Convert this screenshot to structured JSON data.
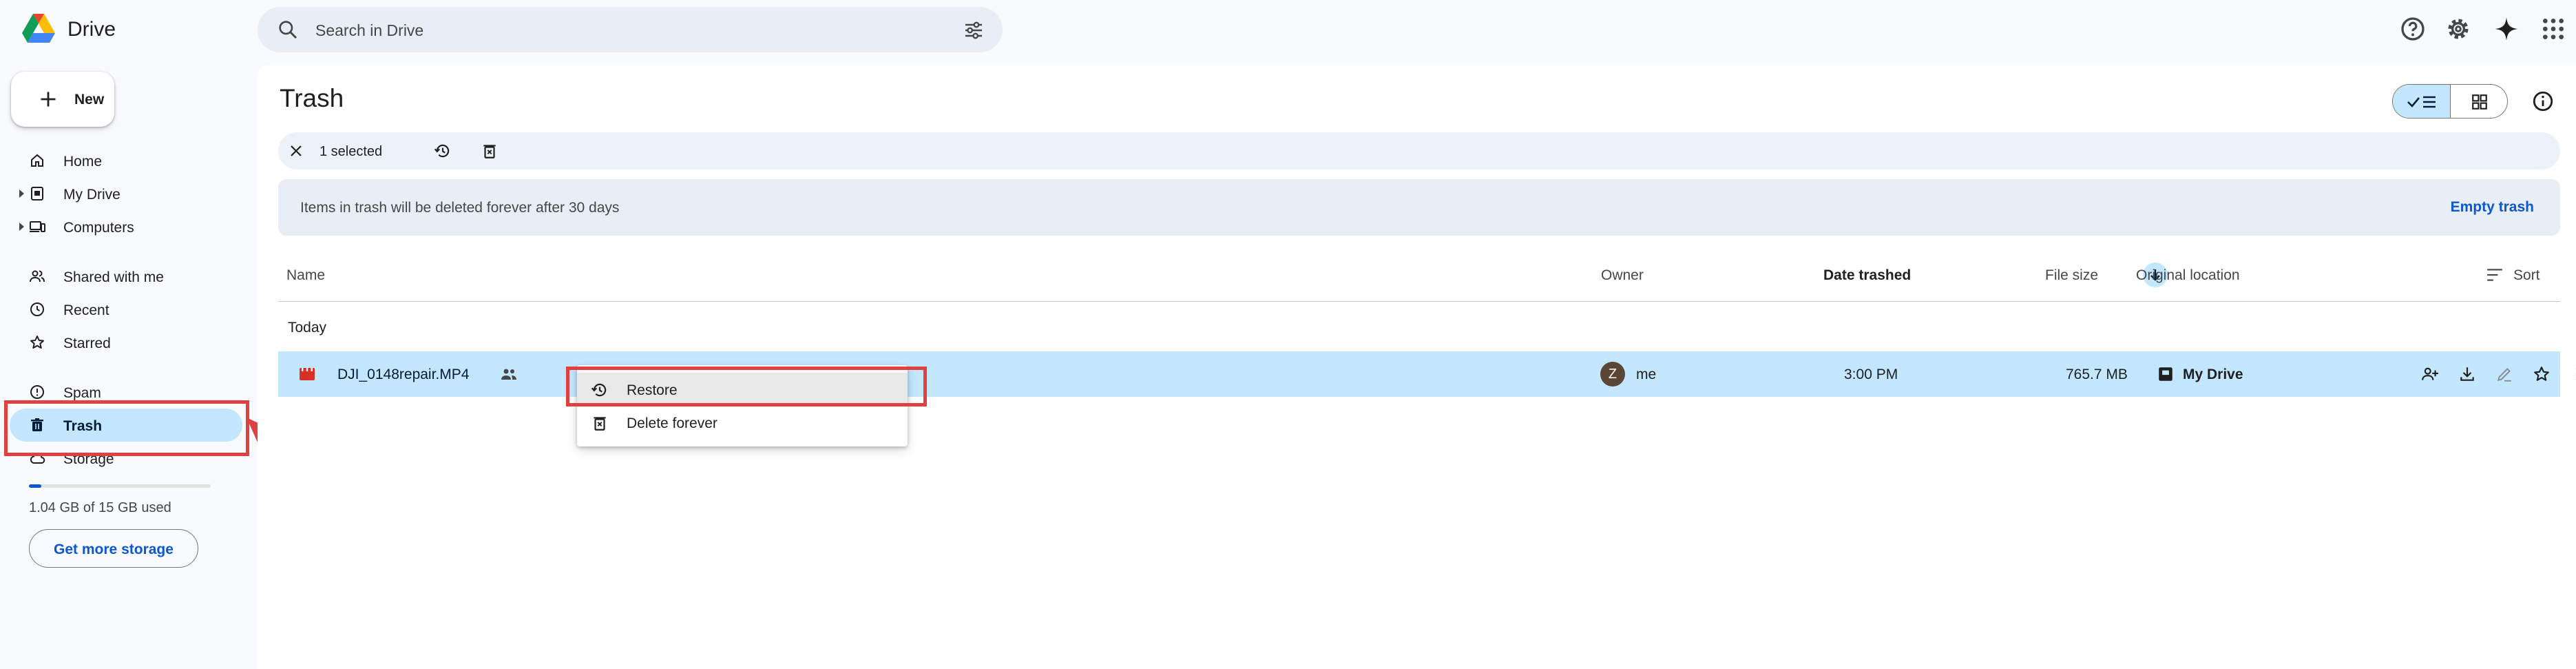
{
  "app": {
    "name": "Drive"
  },
  "search": {
    "placeholder": "Search in Drive"
  },
  "top_icons": [
    "help-icon",
    "gear-icon",
    "sparkle-icon",
    "apps-grid-icon"
  ],
  "sidebar": {
    "new_label": "New",
    "items": [
      {
        "label": "Home",
        "icon": "home-icon"
      },
      {
        "label": "My Drive",
        "icon": "my-drive-icon",
        "expandable": true
      },
      {
        "label": "Computers",
        "icon": "computers-icon",
        "expandable": true
      },
      {
        "label": "Shared with me",
        "icon": "people-icon"
      },
      {
        "label": "Recent",
        "icon": "clock-icon"
      },
      {
        "label": "Starred",
        "icon": "star-icon"
      },
      {
        "label": "Spam",
        "icon": "spam-icon"
      },
      {
        "label": "Trash",
        "icon": "trash-icon",
        "active": true
      },
      {
        "label": "Storage",
        "icon": "cloud-icon"
      }
    ],
    "storage": {
      "used_text": "1.04 GB of 15 GB used",
      "used_fraction": 0.069,
      "button": "Get more storage"
    }
  },
  "main": {
    "title": "Trash",
    "selection": {
      "count_text": "1 selected"
    },
    "banner": {
      "message": "Items in trash will be deleted forever after 30 days",
      "action": "Empty trash"
    },
    "columns": {
      "name": "Name",
      "owner": "Owner",
      "date": "Date trashed",
      "size": "File size",
      "location": "Original location",
      "sort": "Sort"
    },
    "group": "Today",
    "rows": [
      {
        "name": "DJI_0148repair.MP4",
        "owner_initial": "Z",
        "owner": "me",
        "date": "3:00 PM",
        "size": "765.7 MB",
        "location": "My Drive"
      }
    ]
  },
  "context_menu": {
    "items": [
      {
        "label": "Restore",
        "icon": "restore-icon"
      },
      {
        "label": "Delete forever",
        "icon": "delete-forever-icon"
      }
    ]
  },
  "colors": {
    "accent": "#0b57d0",
    "selection": "#c2e7ff",
    "annotation": "#e04040"
  }
}
